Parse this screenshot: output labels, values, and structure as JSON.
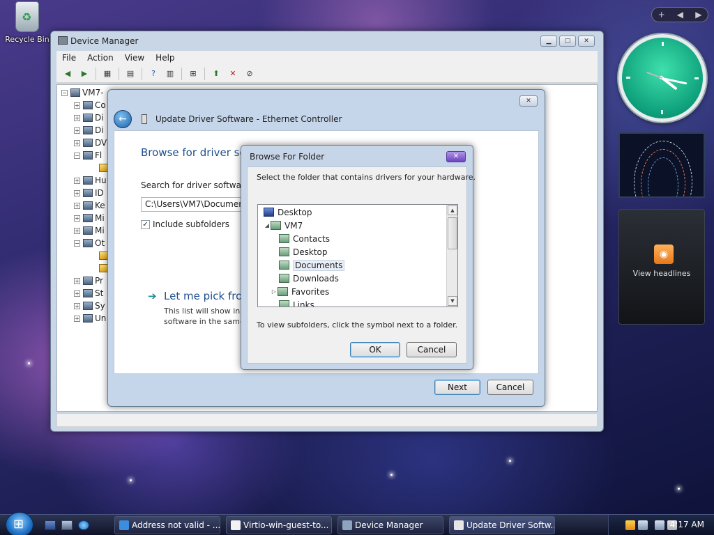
{
  "desktop": {
    "recycle_bin_label": "Recycle Bin"
  },
  "device_manager": {
    "title": "Device Manager",
    "menu": [
      "File",
      "Action",
      "View",
      "Help"
    ],
    "tree": {
      "root": "VM7-",
      "nodes": [
        "Co",
        "Di",
        "Di",
        "DV",
        "Fl",
        "Hu",
        "ID",
        "Ke",
        "Mi",
        "Mi",
        "Ot",
        "Pr",
        "St",
        "Sy",
        "Un"
      ]
    }
  },
  "update_driver": {
    "title": "Update Driver Software - Ethernet Controller",
    "heading": "Browse for driver sof",
    "search_label": "Search for driver software in",
    "path_value": "C:\\Users\\VM7\\Documents",
    "include_subfolders_label": "Include subfolders",
    "include_subfolders_checked": true,
    "pick_link": "Let me pick from",
    "pick_desc_line1": "This list will show inst",
    "pick_desc_line2": "software in the same",
    "next_label": "Next",
    "cancel_label": "Cancel"
  },
  "browse_folder": {
    "title": "Browse For Folder",
    "description": "Select the folder that contains drivers for your hardware.",
    "items": [
      {
        "label": "Desktop",
        "icon": "desktop-icon"
      },
      {
        "label": "VM7",
        "icon": "user-folder-icon"
      },
      {
        "label": "Contacts",
        "icon": "folder-icon"
      },
      {
        "label": "Desktop",
        "icon": "folder-icon"
      },
      {
        "label": "Documents",
        "icon": "folder-icon"
      },
      {
        "label": "Downloads",
        "icon": "folder-icon"
      },
      {
        "label": "Favorites",
        "icon": "favorites-folder-icon"
      },
      {
        "label": "Links",
        "icon": "folder-icon"
      }
    ],
    "selected": "Documents",
    "hint": "To view subfolders, click the symbol next to a folder.",
    "ok_label": "OK",
    "cancel_label": "Cancel"
  },
  "sidebar": {
    "feed_label": "View headlines"
  },
  "taskbar": {
    "tasks": [
      {
        "label": "Address not valid - ...",
        "icon_color": "#3b8de0"
      },
      {
        "label": "Virtio-win-guest-to...",
        "icon_color": "#f2f2f2"
      },
      {
        "label": "Device Manager",
        "icon_color": "#8ea3bd"
      },
      {
        "label": "Update Driver Softw...",
        "icon_color": "#e6e6e6"
      }
    ],
    "time": "4:17 AM"
  }
}
